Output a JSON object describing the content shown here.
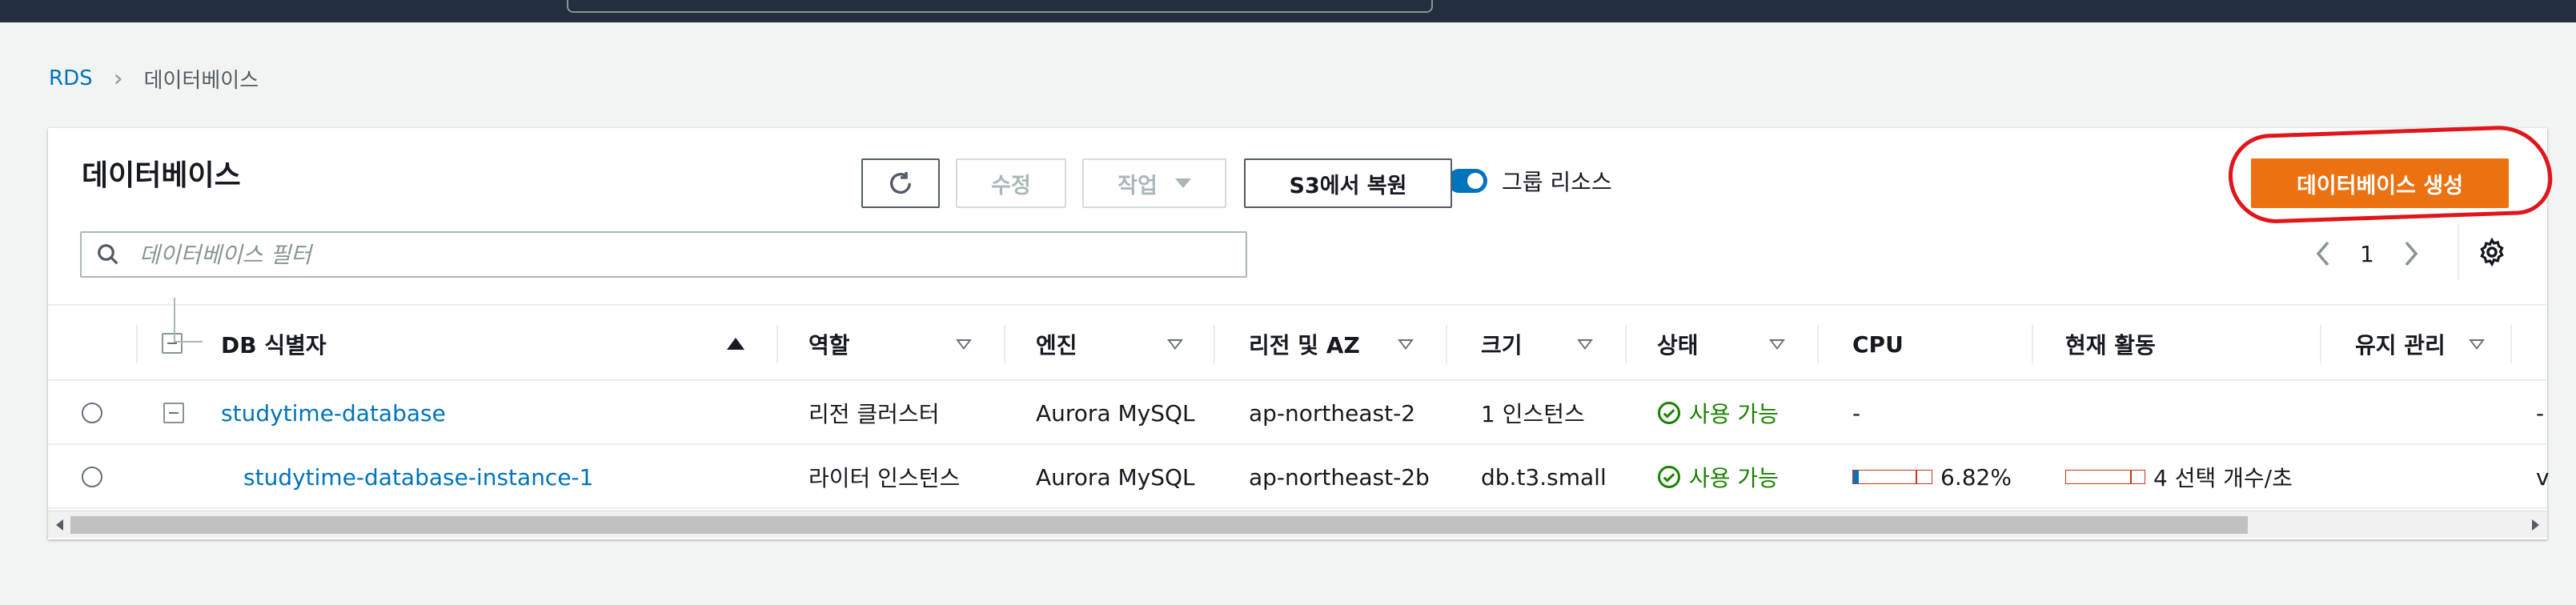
{
  "breadcrumb": {
    "root": "RDS",
    "current": "데이터베이스"
  },
  "panel": {
    "title": "데이터베이스",
    "group_toggle_label": "그룹 리소스",
    "modify_label": "수정",
    "actions_label": "작업",
    "restore_label": "S3에서 복원",
    "create_label": "데이터베이스 생성",
    "filter_placeholder": "데이터베이스 필터",
    "page": "1"
  },
  "colors": {
    "primary": "#ec7211",
    "link": "#0073bb",
    "success": "#1d8102",
    "highlight": "#e0161b"
  },
  "table": {
    "headers": [
      "DB 식별자",
      "역할",
      "엔진",
      "리전 및 AZ",
      "크기",
      "상태",
      "CPU",
      "현재 활동",
      "유지 관리"
    ],
    "rows": [
      {
        "id": "studytime-database",
        "role": "리전 클러스터",
        "engine": "Aurora MySQL",
        "region": "ap-northeast-2",
        "size": "1 인스턴스",
        "status": "사용 가능",
        "cpu": "-",
        "activity": "",
        "maintenance": "-"
      },
      {
        "id": "studytime-database-instance-1",
        "role": "라이터 인스턴스",
        "engine": "Aurora MySQL",
        "region": "ap-northeast-2b",
        "size": "db.t3.small",
        "status": "사용 가능",
        "cpu": "6.82%",
        "cpu_fraction": 0.0682,
        "activity": "4 선택 개수/초",
        "maintenance": "v"
      }
    ]
  }
}
